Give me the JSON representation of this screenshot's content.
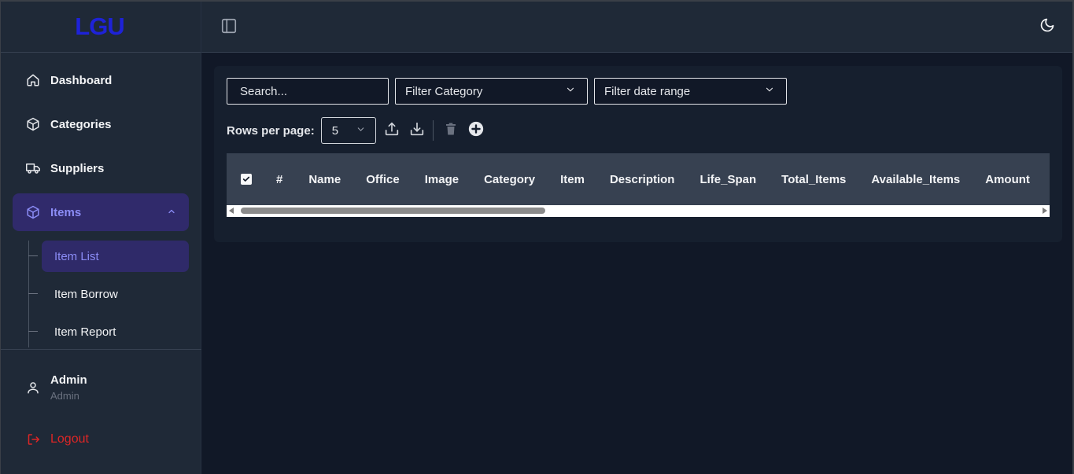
{
  "brand": {
    "logo": "LGU"
  },
  "sidebar": {
    "items": [
      {
        "label": "Dashboard",
        "icon": "home-icon"
      },
      {
        "label": "Categories",
        "icon": "box-icon"
      },
      {
        "label": "Suppliers",
        "icon": "truck-icon"
      },
      {
        "label": "Items",
        "icon": "box-icon",
        "expanded": true
      }
    ],
    "subitems": [
      {
        "label": "Item List",
        "active": true
      },
      {
        "label": "Item Borrow"
      },
      {
        "label": "Item Report"
      }
    ],
    "user": {
      "name": "Admin",
      "role": "Admin"
    },
    "logout_label": "Logout"
  },
  "filters": {
    "search_placeholder": "Search...",
    "category_label": "Filter Category",
    "date_label": "Filter date range"
  },
  "toolbar": {
    "rows_per_page_label": "Rows per page:",
    "rows_per_page_value": "5"
  },
  "table": {
    "columns": [
      "#",
      "Name",
      "Office",
      "Image",
      "Category",
      "Item",
      "Description",
      "Life_Span",
      "Total_Items",
      "Available_Items",
      "Amount"
    ],
    "select_all_checked": true,
    "rows": []
  },
  "colors": {
    "accent": "#8b8cf6",
    "active_bg": "#302a6b",
    "logo": "#1e22d8",
    "logout": "#dc2626",
    "page_bg": "#111827",
    "panel_bg": "#1f2937"
  }
}
